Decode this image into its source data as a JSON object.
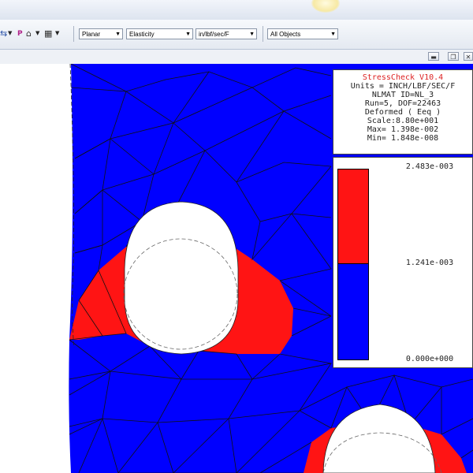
{
  "toolbar": {
    "icons": [
      "filter-icon",
      "p-icon",
      "mesh-icon",
      "solver-icon"
    ],
    "icon_glyphs": [
      "⇆",
      "P",
      "⌂",
      "▦"
    ],
    "combos": [
      "Planar",
      "Elasticity",
      "in/lbf/sec/F",
      "All Objects"
    ]
  },
  "window_buttons": [
    "minimize",
    "restore",
    "close"
  ],
  "info": {
    "title": "StressCheck V10.4",
    "units": "Units = INCH/LBF/SEC/F",
    "nlmat": "NLMAT ID=NL_3",
    "run": "Run=5, DOF=22463",
    "mode": "Deformed ( Eeq )",
    "scale": "Scale:8.80e+001",
    "max": "Max= 1.398e-002",
    "min": "Min= 1.848e-008"
  },
  "legend": {
    "top": "2.483e-003",
    "mid": "1.241e-003",
    "bottom": "0.000e+000",
    "colors": [
      "#ff1414",
      "#0000ff"
    ]
  }
}
